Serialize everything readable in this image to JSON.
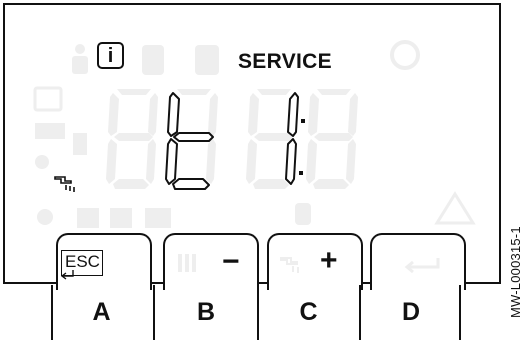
{
  "display": {
    "info_icon_glyph": "i",
    "mode_label": "SERVICE",
    "readout": "t1:",
    "ghost_digits": "88:88",
    "ghost_color": "#eeeeee"
  },
  "softkeys": [
    {
      "key": "A",
      "glyph": "ESC",
      "icon": "esc-back-icon"
    },
    {
      "key": "B",
      "glyph": "−",
      "icon": "minus-icon"
    },
    {
      "key": "C",
      "glyph": "+",
      "icon": "plus-icon"
    },
    {
      "key": "D",
      "glyph": "",
      "icon": "enter-icon"
    }
  ],
  "key_letters": [
    "A",
    "B",
    "C",
    "D"
  ],
  "reference_code": "MW-L000315-1",
  "colors": {
    "ink": "#111111",
    "ghost": "#eeeeee",
    "background": "#ffffff"
  }
}
